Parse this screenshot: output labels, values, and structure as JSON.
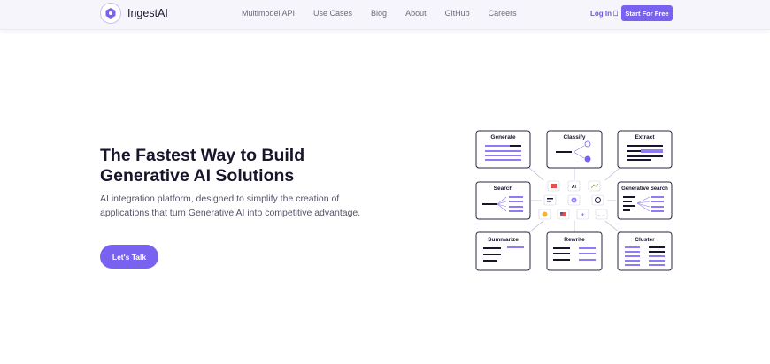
{
  "nav": {
    "brand": "IngestAI",
    "links": [
      "Multimodel API",
      "Use Cases",
      "Blog",
      "About",
      "GitHub",
      "Careers"
    ],
    "login": "Log In",
    "start": "Start For Free"
  },
  "hero": {
    "title_line1": "The Fastest Way to Build",
    "title_line2": "Generative AI Solutions",
    "subtitle": "AI integration platform, designed to simplify the creation of applications that turn Generative AI into competitive advantage.",
    "cta": "Let's Talk"
  },
  "diagram": {
    "cards": {
      "generate": "Generate",
      "classify": "Classify",
      "extract": "Extract",
      "search": "Search",
      "generative_search": "Generative Search",
      "summarize": "Summarize",
      "rewrite": "Rewrite",
      "cluster": "Cluster"
    },
    "model_icon_names": [
      "stack-icon",
      "anthropic-icon",
      "chart-icon",
      "doc-icon",
      "hub-icon",
      "openai-icon",
      "emoji-icon",
      "flag-icon",
      "plus-icon",
      "aws-icon"
    ]
  },
  "colors": {
    "accent": "#7a62f0",
    "accent_light": "#8f7cf4",
    "text_dark": "#17152b",
    "nav_bg": "#f6f5fb"
  }
}
